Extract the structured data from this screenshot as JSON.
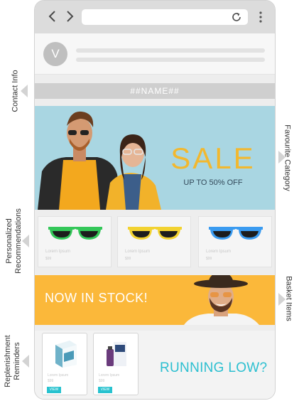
{
  "browser": {
    "back_icon": "chevron-left-icon",
    "forward_icon": "chevron-right-icon",
    "reload_icon": "reload-icon",
    "menu_icon": "more-vertical-icon"
  },
  "email": {
    "avatar_initial": "V",
    "name_placeholder": "##NAME##"
  },
  "sale_banner": {
    "title": "SALE",
    "subtitle": "UP TO 50% OFF"
  },
  "recommendations": [
    {
      "name": "Lorem Ipsum",
      "price": "$99",
      "frame_color": "#34c759"
    },
    {
      "name": "Lorem Ipsum",
      "price": "$99",
      "frame_color": "#f2d230"
    },
    {
      "name": "Lorem Ipsum",
      "price": "$99",
      "frame_color": "#3a9bf0"
    }
  ],
  "stock_banner": {
    "title": "NOW IN STOCK!"
  },
  "replenishment": {
    "products": [
      {
        "name": "Lorem Ipsum",
        "price": "$99",
        "button": "VIEW"
      },
      {
        "name": "Lorem Ipsum",
        "price": "$99",
        "button": "VIEW"
      }
    ],
    "headline": "RUNNING LOW?"
  },
  "annotations": {
    "contact_info": "Contact Info",
    "favourite_category": "Favourite Category",
    "personalized_recommendations": [
      "Personalized",
      "Recommendations"
    ],
    "basket_items": "Basket Items",
    "replenishment_reminders": [
      "Replenishment",
      "Reminders"
    ]
  },
  "colors": {
    "accent_yellow": "#f2b82f",
    "sale_bg": "#a9d6e2",
    "stock_bg": "#fbb83a",
    "teal": "#2bbfd0"
  }
}
